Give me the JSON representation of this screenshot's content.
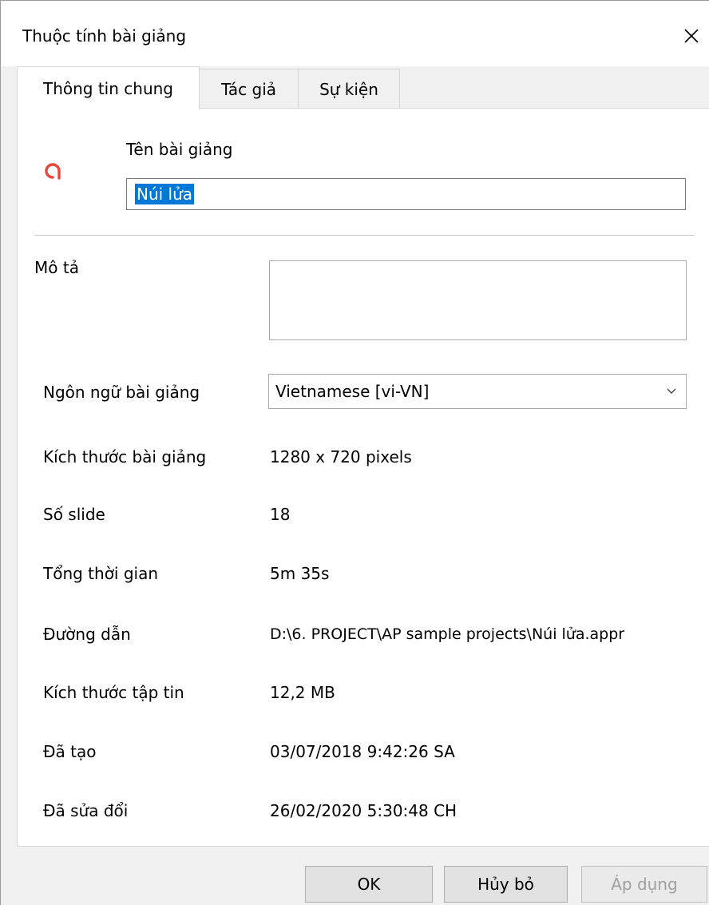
{
  "window": {
    "title": "Thuộc tính bài giảng",
    "close_icon": "close-icon"
  },
  "tabs": [
    {
      "label": "Thông tin chung",
      "active": true
    },
    {
      "label": "Tác giả",
      "active": false
    },
    {
      "label": "Sự kiện",
      "active": false
    }
  ],
  "general": {
    "logo_icon": "app-logo-icon",
    "accent_color": "#e8453c",
    "name_label": "Tên bài giảng",
    "name_value": "Núi lửa",
    "description_label": "Mô tả",
    "description_value": "",
    "language_label": "Ngôn ngữ bài giảng",
    "language_value": "Vietnamese [vi-VN]",
    "size_label": "Kích thước bài giảng",
    "size_value": "1280 x 720 pixels",
    "slides_label": "Số slide",
    "slides_value": "18",
    "duration_label": "Tổng thời gian",
    "duration_value": "5m 35s",
    "path_label": "Đường dẫn",
    "path_value": "D:\\6. PROJECT\\AP sample projects\\Núi lửa.appr",
    "filesize_label": "Kích thước tập tin",
    "filesize_value": "12,2 MB",
    "created_label": "Đã tạo",
    "created_value": "03/07/2018 9:42:26 SA",
    "modified_label": "Đã sửa đổi",
    "modified_value": "26/02/2020 5:30:48 CH"
  },
  "buttons": {
    "ok": "OK",
    "cancel": "Hủy bỏ",
    "apply": "Áp dụng"
  }
}
